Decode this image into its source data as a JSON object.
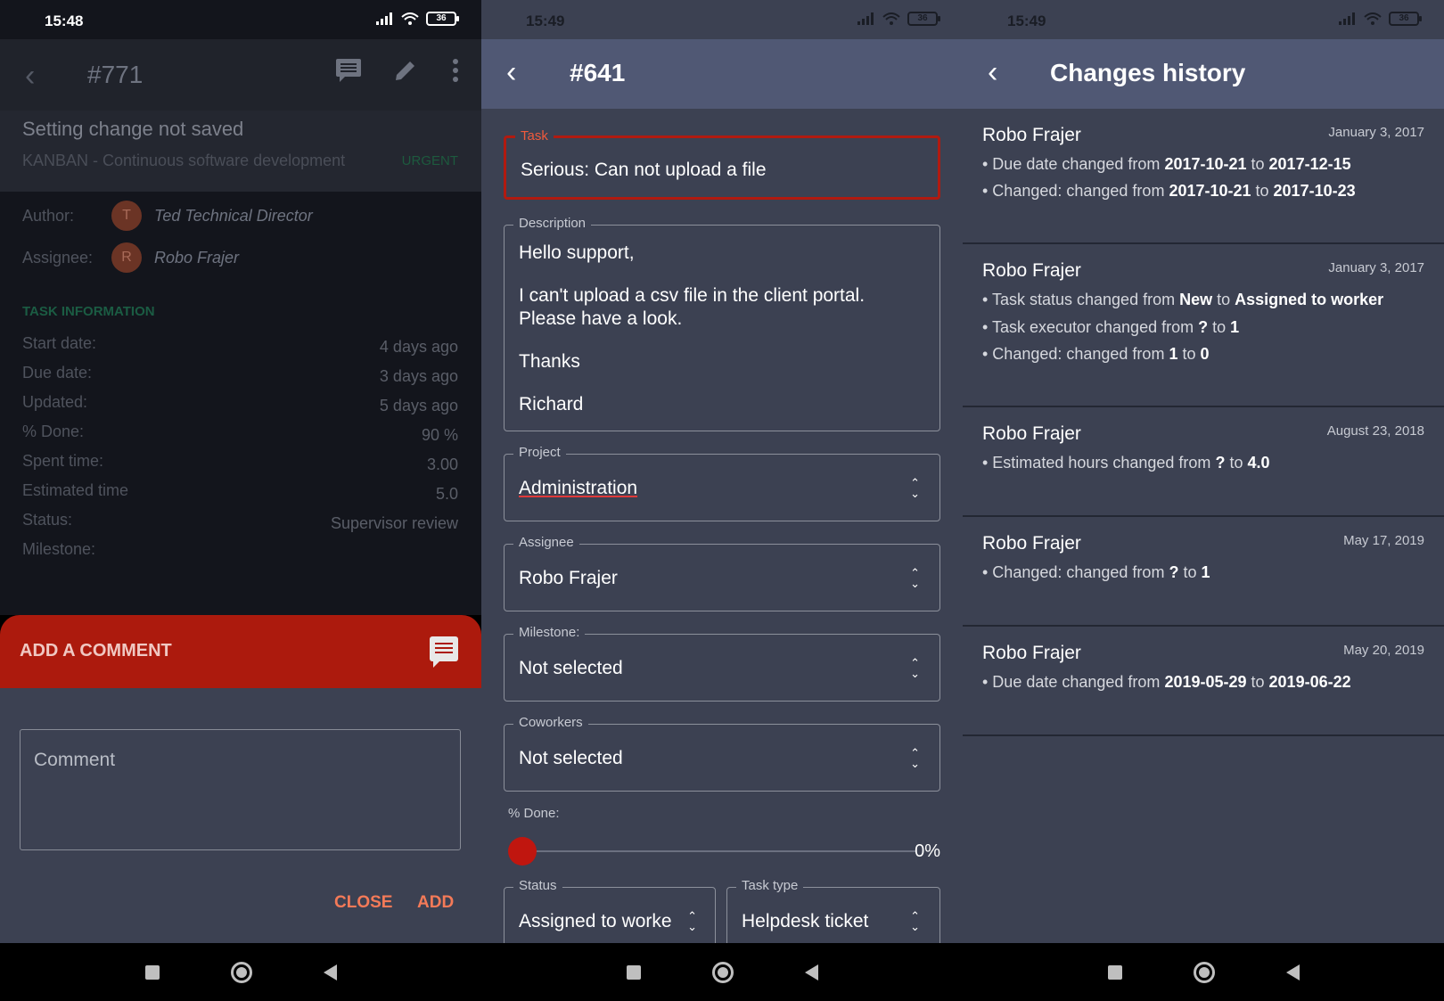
{
  "status": {
    "s1_time": "15:48",
    "s2_time": "15:49",
    "s3_time": "15:49",
    "battery": "36"
  },
  "screen1": {
    "title": "#771",
    "subtitle": "Setting change not saved",
    "project": "KANBAN - Continuous software development",
    "priority": "URGENT",
    "author_label": "Author:",
    "author_initial": "T",
    "author_name": "Ted Technical Director",
    "assignee_label": "Assignee:",
    "assignee_initial": "R",
    "assignee_name": "Robo Frajer",
    "task_info_heading": "TASK INFORMATION",
    "info": [
      {
        "label": "Start date:",
        "value": "4 days ago"
      },
      {
        "label": "Due date:",
        "value": "3 days ago"
      },
      {
        "label": "Updated:",
        "value": "5 days ago"
      },
      {
        "label": "% Done:",
        "value": "90 %"
      },
      {
        "label": "Spent time:",
        "value": "3.00"
      },
      {
        "label": "Estimated time",
        "value": "5.0"
      },
      {
        "label": "Status:",
        "value": "Supervisor review"
      },
      {
        "label": "Milestone:",
        "value": ""
      }
    ],
    "add_comment_label": "ADD A COMMENT",
    "comment_placeholder": "Comment",
    "close_label": "CLOSE",
    "add_label": "ADD"
  },
  "screen2": {
    "title": "#641",
    "task_label": "Task",
    "task_value": "Serious: Can not upload a file",
    "description_label": "Description",
    "description_lines": [
      "Hello support,",
      "I can't upload a csv file in the client portal.",
      "Please have a look.",
      "Thanks",
      "Richard"
    ],
    "project_label": "Project",
    "project_value": "Administration",
    "assignee_label": "Assignee",
    "assignee_value": "Robo Frajer",
    "milestone_label": "Milestone:",
    "milestone_value": "Not selected",
    "coworkers_label": "Coworkers",
    "coworkers_value": "Not selected",
    "done_label": "% Done:",
    "done_value": "0%",
    "done_fraction": 0,
    "status_label": "Status",
    "status_value": "Assigned to worke",
    "task_type_label": "Task type",
    "task_type_value": "Helpdesk ticket"
  },
  "screen3": {
    "title": "Changes history",
    "entries": [
      {
        "who": "Robo Frajer",
        "date": "January 3, 2017",
        "changes": [
          {
            "prefix": "• Due date changed from ",
            "from": "2017-10-21",
            "mid": " to ",
            "to": "2017-12-15"
          },
          {
            "prefix": "• Changed: changed from ",
            "from": "2017-10-21",
            "mid": " to ",
            "to": "2017-10-23"
          }
        ]
      },
      {
        "who": "Robo Frajer",
        "date": "January 3, 2017",
        "changes": [
          {
            "prefix": "• Task status changed from ",
            "from": "New",
            "mid": " to ",
            "to": "Assigned to worker"
          },
          {
            "prefix": "• Task executor changed from ",
            "from": "?",
            "mid": " to ",
            "to": "1"
          },
          {
            "prefix": "• Changed: changed from ",
            "from": "1",
            "mid": " to ",
            "to": "0"
          }
        ]
      },
      {
        "who": "Robo Frajer",
        "date": "August 23, 2018",
        "changes": [
          {
            "prefix": "• Estimated hours changed from ",
            "from": "?",
            "mid": " to ",
            "to": "4.0"
          }
        ]
      },
      {
        "who": "Robo Frajer",
        "date": "May 17, 2019",
        "changes": [
          {
            "prefix": "• Changed: changed from ",
            "from": "?",
            "mid": " to ",
            "to": "1"
          }
        ]
      },
      {
        "who": "Robo Frajer",
        "date": "May 20, 2019",
        "changes": [
          {
            "prefix": "• Due date changed from ",
            "from": "2019-05-29",
            "mid": " to ",
            "to": "2019-06-22"
          }
        ]
      }
    ]
  },
  "icons": {
    "back": "back-arrow-icon",
    "comment": "comment-icon",
    "edit": "pencil-icon",
    "more": "more-vert-icon",
    "updown": "unfold-icon"
  },
  "colors": {
    "accent_red": "#ac1a0d",
    "action_orange": "#f47a58",
    "appbar_blue": "#505874",
    "surface": "#3c4152"
  }
}
